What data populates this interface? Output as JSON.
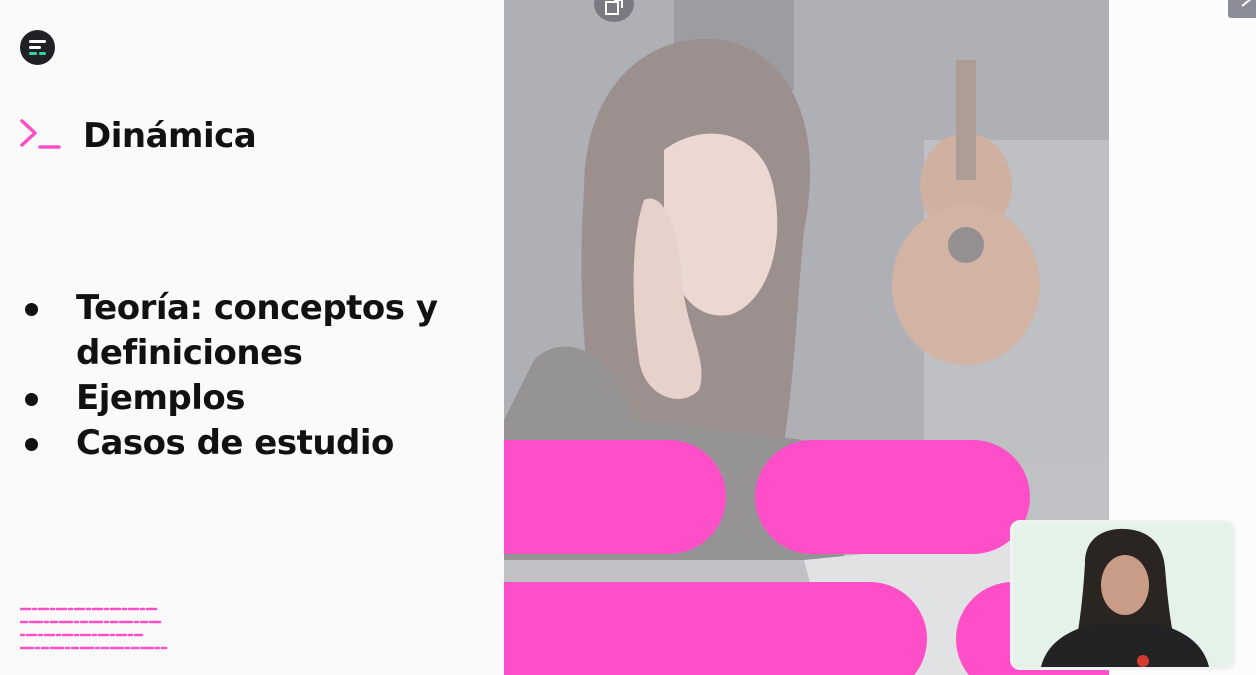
{
  "slide": {
    "title": "Dinámica",
    "bullets": [
      "Teoría: conceptos y definiciones",
      "Ejemplos",
      "Casos de estudio"
    ]
  },
  "icons": {
    "logo": "brand-logo-icon",
    "prompt": "terminal-prompt-icon",
    "share": "share-icon",
    "expand": "expand-icon"
  },
  "colors": {
    "accent": "#ff4fc8",
    "text": "#111111",
    "background": "#fafafa"
  }
}
